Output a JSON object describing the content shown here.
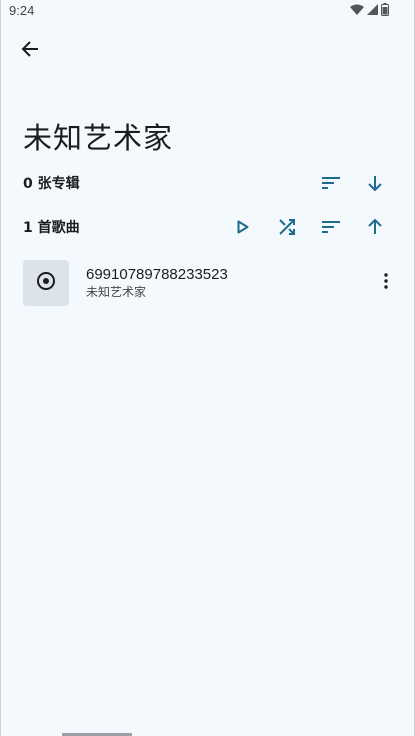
{
  "status_bar": {
    "time": "9:24",
    "icons": [
      "wifi-icon",
      "signal-icon",
      "battery-icon"
    ]
  },
  "header": {
    "back_icon": "arrow-left-icon"
  },
  "artist": {
    "name": "未知艺术家"
  },
  "albums_section": {
    "label": "0 张专辑",
    "actions": [
      "sort-icon",
      "arrow-down-icon"
    ]
  },
  "songs_section": {
    "label": "1 首歌曲",
    "actions": [
      "play-icon",
      "shuffle-icon",
      "sort-icon",
      "arrow-up-icon"
    ]
  },
  "songs": [
    {
      "title": "69910789788233523",
      "artist": "未知艺术家",
      "art_icon": "disc-icon",
      "menu_icon": "more-vert-icon"
    }
  ],
  "colors": {
    "background": "#f4f9fe",
    "accent": "#1f6b8e",
    "text": "#1b1c1e",
    "album_art_bg": "#dde3ea"
  }
}
